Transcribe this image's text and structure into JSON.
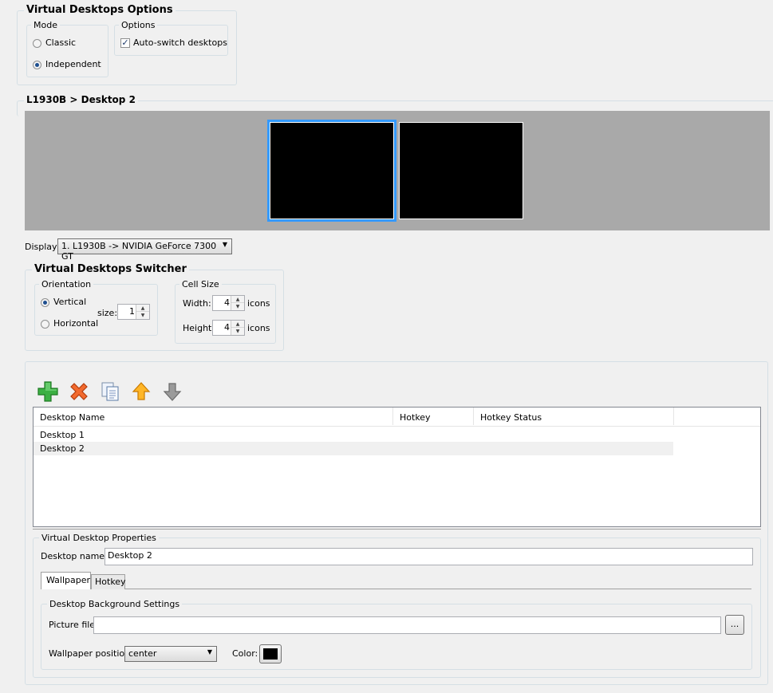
{
  "options_group": {
    "title": "Virtual Desktops Options",
    "mode": {
      "title": "Mode",
      "classic": "Classic",
      "independent": "Independent",
      "selected": "Independent"
    },
    "options": {
      "title": "Options",
      "auto_switch": "Auto-switch desktops",
      "auto_switch_checked": true
    }
  },
  "preview": {
    "title": "L1930B > Desktop 2",
    "desktops": [
      "Desktop 1",
      "Desktop 2"
    ],
    "selected_index": 0,
    "display_label": "Display:",
    "display_value": "1. L1930B -> NVIDIA GeForce 7300 GT"
  },
  "switcher": {
    "title": "Virtual Desktops Switcher",
    "orientation": {
      "title": "Orientation",
      "vertical": "Vertical",
      "horizontal": "Horizontal",
      "selected": "Vertical",
      "size_label": "size:",
      "size_value": "1"
    },
    "cell_size": {
      "title": "Cell Size",
      "width_label": "Width:",
      "width_value": "4",
      "height_label": "Height:",
      "height_value": "4",
      "units": "icons"
    }
  },
  "toolbar": {
    "icons": [
      "add-icon",
      "delete-icon",
      "copy-icon",
      "move-up-icon",
      "move-down-icon"
    ]
  },
  "table": {
    "columns": [
      "Desktop Name",
      "Hotkey",
      "Hotkey Status"
    ],
    "rows": [
      {
        "name": "Desktop 1",
        "hotkey": "",
        "status": ""
      },
      {
        "name": "Desktop 2",
        "hotkey": "",
        "status": ""
      }
    ],
    "selected_row": 1
  },
  "properties": {
    "title": "Virtual Desktop Properties",
    "name_label": "Desktop name:",
    "name_value": "Desktop 2",
    "tabs": [
      "Wallpaper",
      "Hotkey"
    ],
    "active_tab": "Wallpaper",
    "background": {
      "title": "Desktop Background Settings",
      "picture_label": "Picture file:",
      "picture_value": "",
      "browse_label": "...",
      "position_label": "Wallpaper position:",
      "position_value": "center",
      "color_label": "Color:",
      "color_value": "#000000"
    }
  },
  "colors": {
    "accent": "#3399ff",
    "preview_bg": "#a9a9a9",
    "desktop_fill": "#000000",
    "selected_row": "#f0f0f0"
  }
}
